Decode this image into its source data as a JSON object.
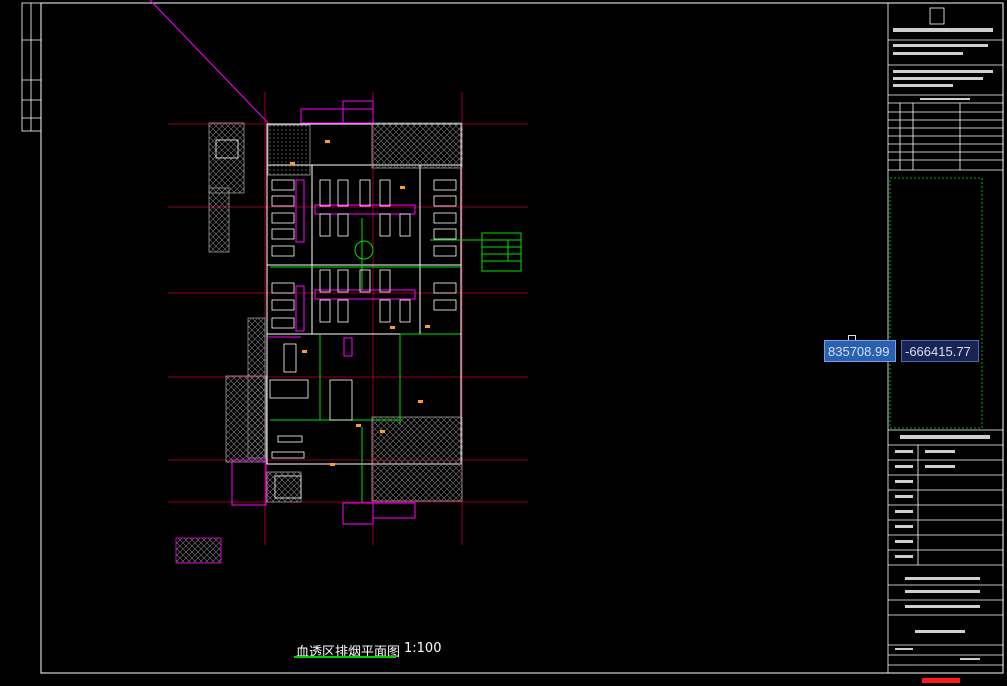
{
  "drawing": {
    "title": "血透区排烟平面图",
    "scale": "1:100"
  },
  "coordinates": {
    "x": "835708.99",
    "y": "-666415.77"
  },
  "colors": {
    "background": "#000000",
    "frame": "#ffffff",
    "axis": "#c0002a",
    "wall": "#ffffff",
    "duct": "#ff00ff",
    "pipe": "#00e000",
    "hatch": "#8a8a8a",
    "marker": "#ff1b1b",
    "coord_x_bg": "#2b5fb0",
    "coord_y_bg": "#1a2452"
  }
}
